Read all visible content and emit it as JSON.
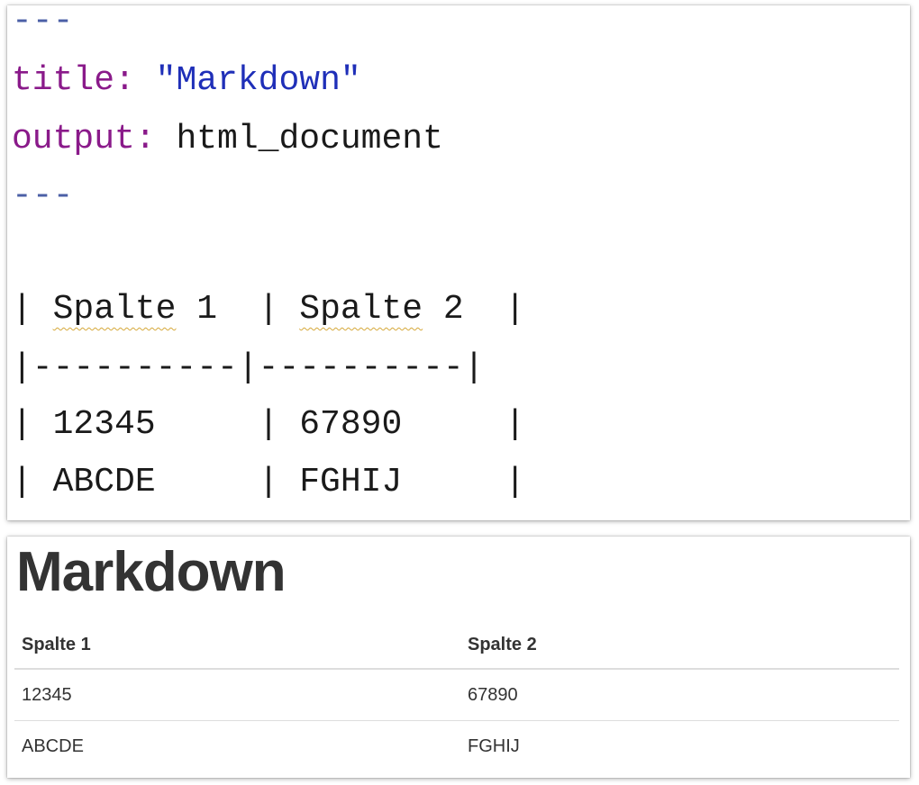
{
  "editor": {
    "fence_open": "---",
    "title_key": "title:",
    "title_value": "\"Markdown\"",
    "output_key": "output:",
    "output_value": "html_document",
    "fence_close": "---",
    "table_lines": {
      "header_col1_pre": "| ",
      "header_col1_word": "Spalte",
      "header_col1_post": " 1  | ",
      "header_col2_word": "Spalte",
      "header_col2_post": " 2  |",
      "separator": "|----------|----------|",
      "row1": "| 12345     | 67890     |",
      "row2": "| ABCDE     | FGHIJ     |"
    }
  },
  "preview": {
    "title": "Markdown",
    "columns": [
      "Spalte 1",
      "Spalte 2"
    ],
    "rows": [
      [
        "12345",
        "67890"
      ],
      [
        "ABCDE",
        "FGHIJ"
      ]
    ]
  },
  "colors": {
    "fence": "#4b5fa6",
    "yaml_key": "#8a1a8a",
    "yaml_string": "#1f2fb8",
    "spellcheck_squiggle": "#d6a83a"
  }
}
